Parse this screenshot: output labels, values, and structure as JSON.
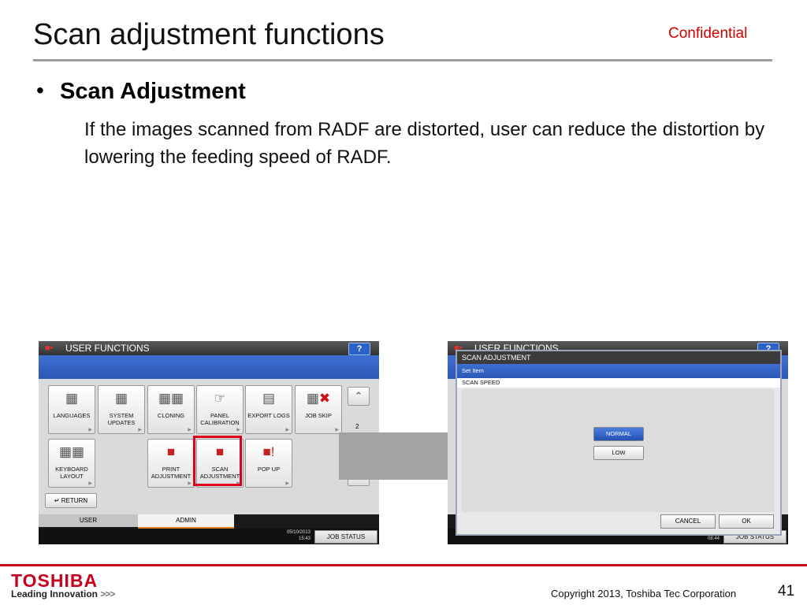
{
  "slide": {
    "title": "Scan adjustment functions",
    "confidential": "Confidential",
    "bullet_heading": "Scan Adjustment",
    "bullet_body": "If the images scanned from RADF are distorted, user can reduce the distortion by lowering the feeding speed of RADF."
  },
  "footer": {
    "brand": "TOSHIBA",
    "tagline": "Leading Innovation",
    "tagline_chevrons": ">>>",
    "copyright": "Copyright 2013, Toshiba Tec Corporation",
    "page_number": "41"
  },
  "left_panel": {
    "title": "USER FUNCTIONS",
    "help": "?",
    "buttons": {
      "languages": "LANGUAGES",
      "system_updates": "SYSTEM UPDATES",
      "cloning": "CLONING",
      "panel_calibration": "PANEL CALIBRATION",
      "export_logs": "EXPORT LOGS",
      "job_skip": "JOB SKIP",
      "keyboard_layout": "KEYBOARD LAYOUT",
      "print_adjustment": "PRINT ADJUSTMENT",
      "scan_adjustment": "SCAN ADJUSTMENT",
      "pop_up": "POP UP"
    },
    "page_indicator": "2",
    "return_label": "RETURN",
    "tabs": {
      "user": "USER",
      "admin": "ADMIN"
    },
    "date": "05/10/2013",
    "time": "15:43",
    "job_status": "JOB STATUS",
    "highlight_color": "#e0001a"
  },
  "right_panel": {
    "title": "USER FUNCTIONS",
    "help": "?",
    "dialog": {
      "title": "SCAN ADJUSTMENT",
      "set_item": "Set Item",
      "scan_speed": "SCAN SPEED",
      "options": [
        "NORMAL",
        "LOW"
      ],
      "selected": "NORMAL",
      "cancel": "CANCEL",
      "ok": "OK"
    },
    "time": "08:44",
    "job_status": "JOB STATUS"
  },
  "colors": {
    "footer_red": "#c8001c",
    "confidential_red": "#d40000",
    "panel_blue": "#2c58b8",
    "arrow_gray": "#a3a3a3"
  },
  "icons": {
    "panel_menu": "printer-icon",
    "flow_arrow": "right-arrow-icon"
  }
}
